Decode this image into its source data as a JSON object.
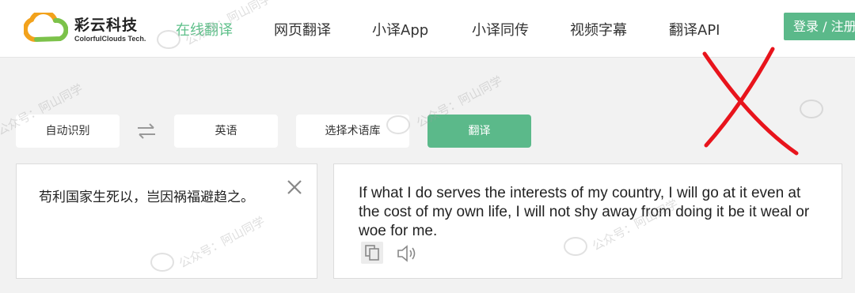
{
  "brand": {
    "name_cn": "彩云科技",
    "name_en": "ColorfulClouds Tech."
  },
  "nav": {
    "items": [
      {
        "label": "在线翻译",
        "active": true
      },
      {
        "label": "网页翻译",
        "active": false
      },
      {
        "label": "小译App",
        "active": false
      },
      {
        "label": "小译同传",
        "active": false
      },
      {
        "label": "视频字幕",
        "active": false
      },
      {
        "label": "翻译API",
        "active": false
      }
    ],
    "login_label": "登录 / 注册"
  },
  "toolbar": {
    "source_lang": "自动识别",
    "target_lang": "英语",
    "glossary_label": "选择术语库",
    "translate_label": "翻译"
  },
  "source": {
    "text": "苟利国家生死以，岂因祸福避趋之。"
  },
  "target": {
    "text": "If what I do serves the interests of my country, I will go at it even at the cost of my own life, I will not shy away from doing it be it weal or woe for me."
  },
  "watermark": {
    "text": "公众号：阿山同学"
  },
  "colors": {
    "accent": "#5bb98a",
    "active_nav": "#5ec08a",
    "annotation": "#e8141c"
  },
  "icons": [
    "logo-cloud-icon",
    "swap-arrows-icon",
    "close-icon",
    "copy-icon",
    "speaker-icon"
  ]
}
